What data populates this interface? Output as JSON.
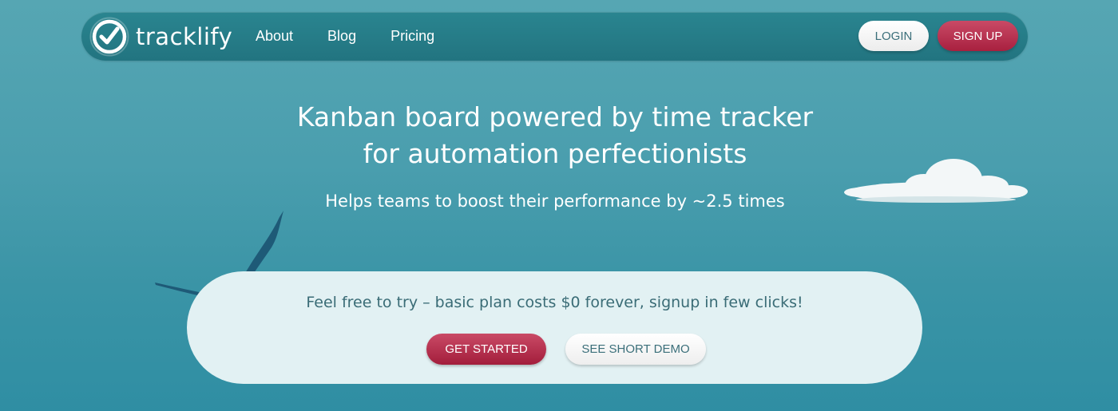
{
  "header": {
    "logo_text": "tracklify",
    "logo_icon": "clock-check-icon",
    "nav": [
      {
        "label": "About"
      },
      {
        "label": "Blog"
      },
      {
        "label": "Pricing"
      }
    ],
    "login_label": "LOGIN",
    "signup_label": "SIGN UP"
  },
  "hero": {
    "title_line1": "Kanban board powered by time tracker",
    "title_line2": "for automation perfectionists",
    "subtitle": "Helps teams to boost their performance by ~2.5 times"
  },
  "cta": {
    "text": "Feel free to try – basic plan costs $0 forever, signup in few clicks!",
    "get_started_label": "GET STARTED",
    "demo_label": "SEE SHORT DEMO"
  },
  "decorations": {
    "cloud": "cloud-illustration",
    "bird": "bird-illustration"
  },
  "colors": {
    "background": "#4a9eae",
    "navbar": "#227480",
    "accent": "#b02a48",
    "cta_panel": "#e2f1f3",
    "cta_text": "#3a6c76"
  }
}
